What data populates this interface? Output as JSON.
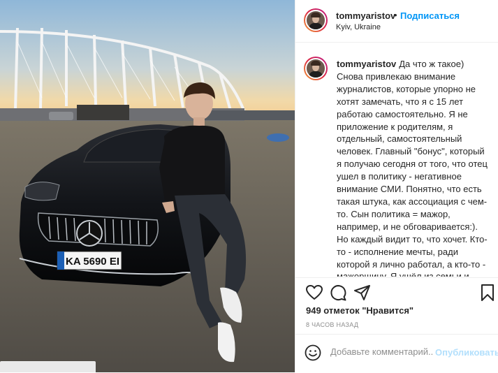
{
  "post": {
    "photo": {
      "alt": "photo",
      "plate_text": "KA 5690 EI"
    },
    "header": {
      "username": "tommyaristov",
      "separator": "•",
      "follow_label": "Подписаться",
      "location": "Kyiv, Ukraine"
    },
    "caption": {
      "username": "tommyaristov",
      "text": "Да что ж такое) Снова привлекаю внимание журналистов, которые упорно не хотят замечать, что я с 15 лет работаю самостоятельно. Я не приложение к родителям, я отдельный, самостоятельный человек. Главный \"бонус\", который я получаю сегодня от того, что отец ушел в политику - негативное внимание СМИ. Понятно, что есть такая штука, как ассоциация с чем-то. Сын политика = мажор, например, и не обговаривается:). Но каждый видит то, что хочет. Кто-то - исполнение мечты, ради которой я лично работал, а кто-то - мажорщину. Я ушёл из семьи и начал заниматься тем что родителям было совсем не по душе, экстримом и съёмками, что"
    },
    "actions": {
      "like_icon": "heart-icon",
      "comment_icon": "comment-icon",
      "share_icon": "paper-plane-icon",
      "save_icon": "bookmark-icon"
    },
    "likes_text": "949 отметок \"Нравится\"",
    "time_ago": "8 ЧАСОВ НАЗАД",
    "comment": {
      "emoji_icon": "smile-icon",
      "placeholder": "Добавьте комментарий...",
      "publish_label": "Опубликовать"
    }
  },
  "colors": {
    "accent": "#0095f6",
    "publish_disabled": "#b2dffc",
    "border": "#efefef",
    "meta": "#8e8e8e",
    "text": "#262626"
  }
}
